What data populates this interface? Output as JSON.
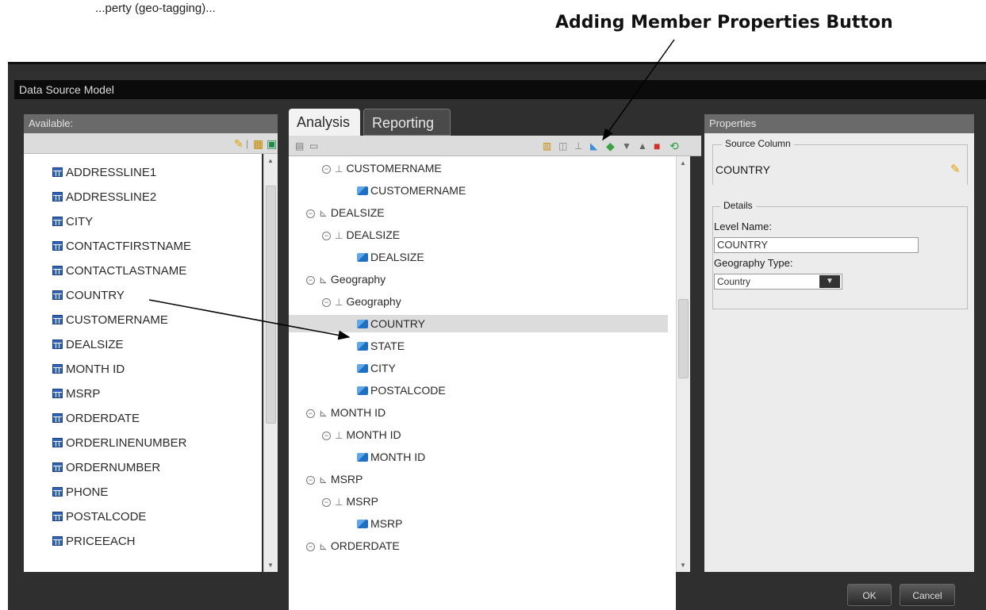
{
  "annotation": {
    "label": "Adding Member Properties Button",
    "partial_text": "...perty (geo-tagging)..."
  },
  "window": {
    "title": "Data Source Model"
  },
  "available": {
    "header": "Available:",
    "items": [
      "ADDRESSLINE1",
      "ADDRESSLINE2",
      "CITY",
      "CONTACTFIRSTNAME",
      "CONTACTLASTNAME",
      "COUNTRY",
      "CUSTOMERNAME",
      "DEALSIZE",
      "MONTH ID",
      "MSRP",
      "ORDERDATE",
      "ORDERLINENUMBER",
      "ORDERNUMBER",
      "PHONE",
      "POSTALCODE",
      "PRICEEACH"
    ]
  },
  "tabs": [
    "Analysis",
    "Reporting"
  ],
  "tree": [
    {
      "type": "hierarchy",
      "label": "CUSTOMERNAME",
      "exp": "⊟"
    },
    {
      "type": "level",
      "label": "CUSTOMERNAME"
    },
    {
      "type": "dimension",
      "label": "DEALSIZE",
      "exp": "⊟"
    },
    {
      "type": "hierarchy",
      "label": "DEALSIZE",
      "exp": "⊟"
    },
    {
      "type": "level",
      "label": "DEALSIZE"
    },
    {
      "type": "dimension",
      "label": "Geography",
      "exp": "⊟"
    },
    {
      "type": "hierarchy",
      "label": "Geography",
      "exp": "⊟"
    },
    {
      "type": "level",
      "label": "COUNTRY",
      "selected": true
    },
    {
      "type": "level",
      "label": "STATE"
    },
    {
      "type": "level",
      "label": "CITY"
    },
    {
      "type": "level",
      "label": "POSTALCODE"
    },
    {
      "type": "dimension",
      "label": "MONTH ID",
      "exp": "⊟"
    },
    {
      "type": "hierarchy",
      "label": "MONTH ID",
      "exp": "⊟"
    },
    {
      "type": "level",
      "label": "MONTH ID"
    },
    {
      "type": "dimension",
      "label": "MSRP",
      "exp": "⊟"
    },
    {
      "type": "hierarchy",
      "label": "MSRP",
      "exp": "⊟"
    },
    {
      "type": "level",
      "label": "MSRP"
    },
    {
      "type": "dimension",
      "label": "ORDERDATE",
      "exp": "⊟"
    }
  ],
  "properties": {
    "header": "Properties",
    "source_legend": "Source Column",
    "source_value": "COUNTRY",
    "details_legend": "Details",
    "level_name_label": "Level Name:",
    "level_name_value": "COUNTRY",
    "geo_type_label": "Geography Type:",
    "geo_type_value": "Country"
  },
  "buttons": {
    "ok": "OK",
    "cancel": "Cancel"
  },
  "colors": {
    "selected_row": "#dcdcdc",
    "dialog_bg": "#2f2f2f",
    "tab_active": "#f2f2f2",
    "tab_inactive": "#4a4a4a"
  }
}
